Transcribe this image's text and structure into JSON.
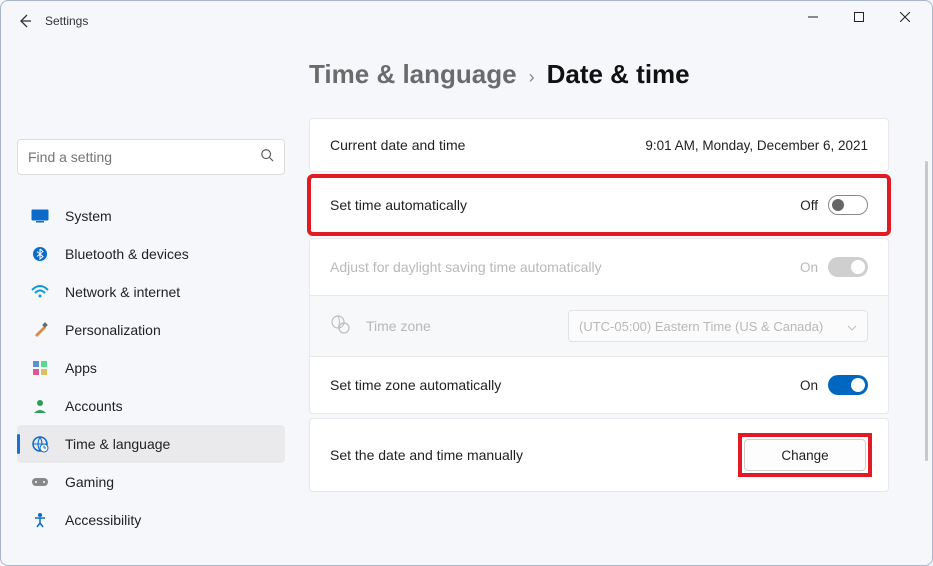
{
  "window": {
    "title": "Settings"
  },
  "search": {
    "placeholder": "Find a setting"
  },
  "sidebar": {
    "items": [
      {
        "label": "System"
      },
      {
        "label": "Bluetooth & devices"
      },
      {
        "label": "Network & internet"
      },
      {
        "label": "Personalization"
      },
      {
        "label": "Apps"
      },
      {
        "label": "Accounts"
      },
      {
        "label": "Time & language"
      },
      {
        "label": "Gaming"
      },
      {
        "label": "Accessibility"
      }
    ]
  },
  "breadcrumb": {
    "parent": "Time & language",
    "sep": "›",
    "current": "Date & time"
  },
  "rows": {
    "current": {
      "label": "Current date and time",
      "value": "9:01 AM, Monday, December 6, 2021"
    },
    "autoTime": {
      "label": "Set time automatically",
      "state": "Off"
    },
    "dst": {
      "label": "Adjust for daylight saving time automatically",
      "state": "On"
    },
    "zone": {
      "label": "Time zone",
      "value": "(UTC-05:00) Eastern Time (US & Canada)"
    },
    "autoZone": {
      "label": "Set time zone automatically",
      "state": "On"
    },
    "manual": {
      "label": "Set the date and time manually",
      "button": "Change"
    }
  }
}
